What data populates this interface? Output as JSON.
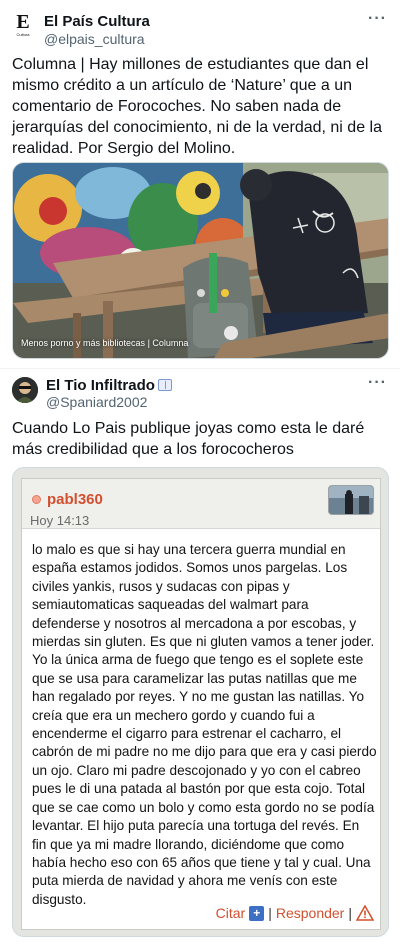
{
  "tweet1": {
    "author_name": "El País Cultura",
    "author_handle": "@elpais_cultura",
    "avatar_letter": "E",
    "avatar_sub": "Cultura",
    "text": "Columna | Hay millones de estudiantes que dan el mismo crédito a un artículo de ‘Nature’ que a un comentario de Forocoches. No saben nada de jerarquías del conocimiento, ni de la verdad, ni de la realidad. Por Sergio del Molino.",
    "media_caption": "Menos porno y más bibliotecas | Columna",
    "more": "···"
  },
  "tweet2": {
    "author_name": "El Tio Infiltrado",
    "author_handle": "@Spaniard2002",
    "text": "Cuando Lo Pais publique joyas como esta le daré más credibilidad que a los forococheros",
    "more": "···"
  },
  "forum_post": {
    "username": "pabl360",
    "time": "Hoy 14:13",
    "body": "lo malo es que si hay una tercera guerra mundial en españa estamos jodidos. Somos unos pargelas. Los civiles yankis, rusos y sudacas con pipas y semiautomaticas saqueadas del walmart para defenderse y nosotros al mercadona a por escobas, y mierdas sin gluten. Es que ni gluten vamos a tener joder. Yo la única arma de fuego que tengo es el soplete este que se usa para caramelizar las putas natillas que me han regalado por reyes. Y no me gustan las natillas. Yo creía que era un mechero gordo y cuando fui a encenderme el cigarro para estrenar el cacharro, el cabrón de mi padre no me dijo para que era y casi pierdo un ojo. Claro mi padre descojonado y yo con el cabreo pues le di una patada al bastón por que esta cojo. Total que se cae como un bolo y como esta gordo no se podía levantar. El hijo puta parecía una tortuga del revés. En fin que ya mi madre llorando, diciéndome que como había hecho eso con 65 años que tiene y tal y cual. Una puta mierda de navidad y ahora me venís con este disgusto.",
    "cite_label": "Citar",
    "reply_label": "Responder",
    "separator": "|"
  },
  "colors": {
    "forum_accent": "#d2502f",
    "cite_icon": "#3d6fc4",
    "secondary_text": "#536471"
  }
}
